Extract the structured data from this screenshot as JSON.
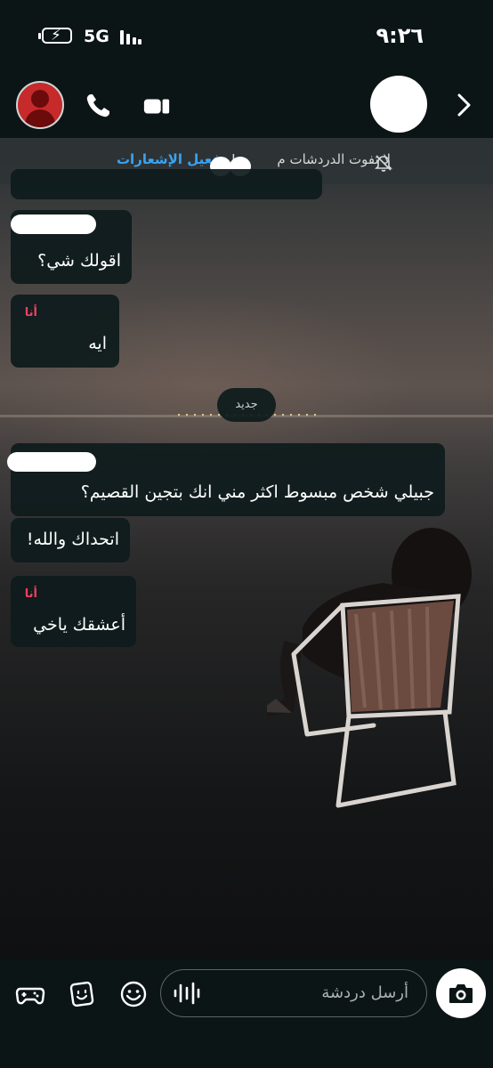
{
  "status_bar": {
    "network": "5G",
    "time": "٩:٢٦"
  },
  "header": {
    "avatar_icon": "bitmoji-avatar-icon",
    "call_icon": "phone-icon",
    "video_icon": "video-camera-icon",
    "more_icon": "chevron-right-icon"
  },
  "notification_bar": {
    "text": "لا تفوت الدردشات م",
    "text_suffix": "!",
    "link": "تفعيل الإشعارات",
    "icon": "bell-off-icon"
  },
  "messages": [
    {
      "sender": "friend",
      "text": "اقولك شي؟"
    },
    {
      "sender": "me",
      "label": "أنا",
      "text": "ايه"
    },
    {
      "type": "divider",
      "text": "جديد"
    },
    {
      "sender": "friend",
      "text": "جبيلي شخص مبسوط اكثر مني انك بتجين القصيم؟"
    },
    {
      "sender": "friend",
      "text": "اتحداك والله!"
    },
    {
      "sender": "me",
      "label": "أنا",
      "text": "أعشقك ياخي"
    }
  ],
  "composer": {
    "placeholder": "أرسل دردشة",
    "icons": [
      "game-controller-icon",
      "sticker-icon",
      "emoji-icon",
      "voice-note-icon",
      "camera-icon"
    ]
  },
  "colors": {
    "background": "#0c1516",
    "bubble": "#0e1b1c",
    "link": "#3aa3f2",
    "me_label": "#f2405d"
  }
}
